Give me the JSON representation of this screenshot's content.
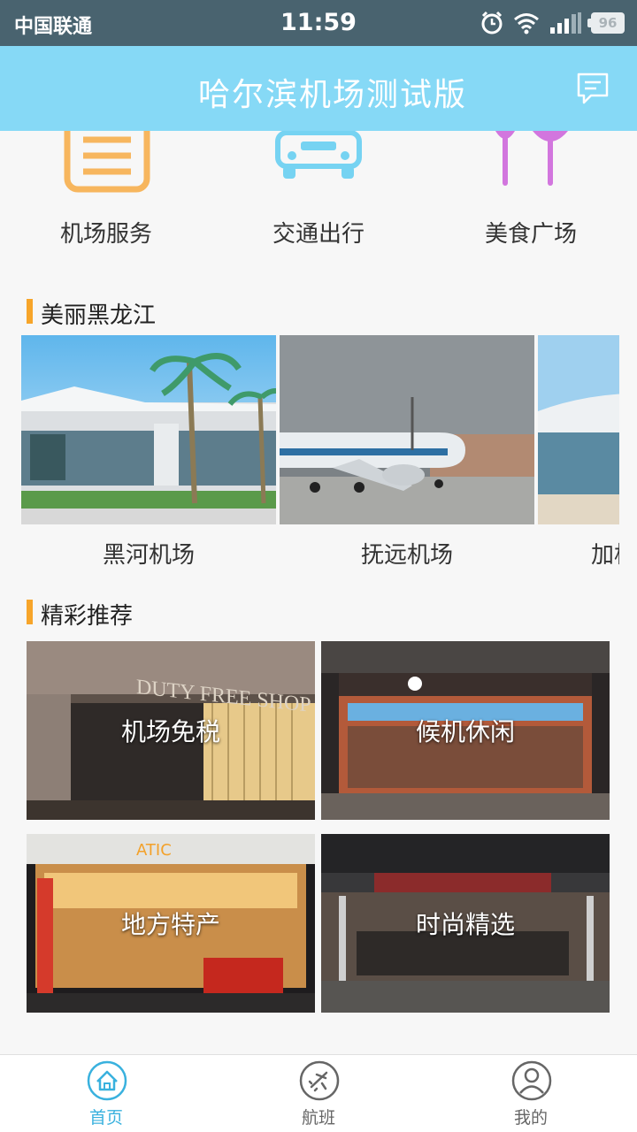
{
  "status_bar": {
    "carrier": "中国联通",
    "time": "11:59",
    "battery": "96"
  },
  "header": {
    "title": "哈尔滨机场测试版",
    "message_icon": "message-icon"
  },
  "services": [
    {
      "label": "机场服务",
      "icon": "document-icon",
      "color": "#f7b65e"
    },
    {
      "label": "交通出行",
      "icon": "car-icon",
      "color": "#76d3f2"
    },
    {
      "label": "美食广场",
      "icon": "utensils-icon",
      "color": "#d276de"
    }
  ],
  "sections": {
    "scenic_title": "美丽黑龙江",
    "recommend_title": "精彩推荐"
  },
  "airports": [
    {
      "label": "黑河机场"
    },
    {
      "label": "抚远机场"
    },
    {
      "label": "加格达奇机场"
    }
  ],
  "recommendations": [
    {
      "label": "机场免税"
    },
    {
      "label": "候机休闲"
    },
    {
      "label": "地方特产"
    },
    {
      "label": "时尚精选"
    }
  ],
  "tabs": [
    {
      "label": "首页",
      "icon": "home-icon",
      "active": true
    },
    {
      "label": "航班",
      "icon": "airplane-icon",
      "active": false
    },
    {
      "label": "我的",
      "icon": "user-icon",
      "active": false
    }
  ],
  "colors": {
    "header": "#86d9f6",
    "status_bar": "#49636f",
    "accent": "#f7a52a",
    "tab_active": "#39b1de"
  }
}
